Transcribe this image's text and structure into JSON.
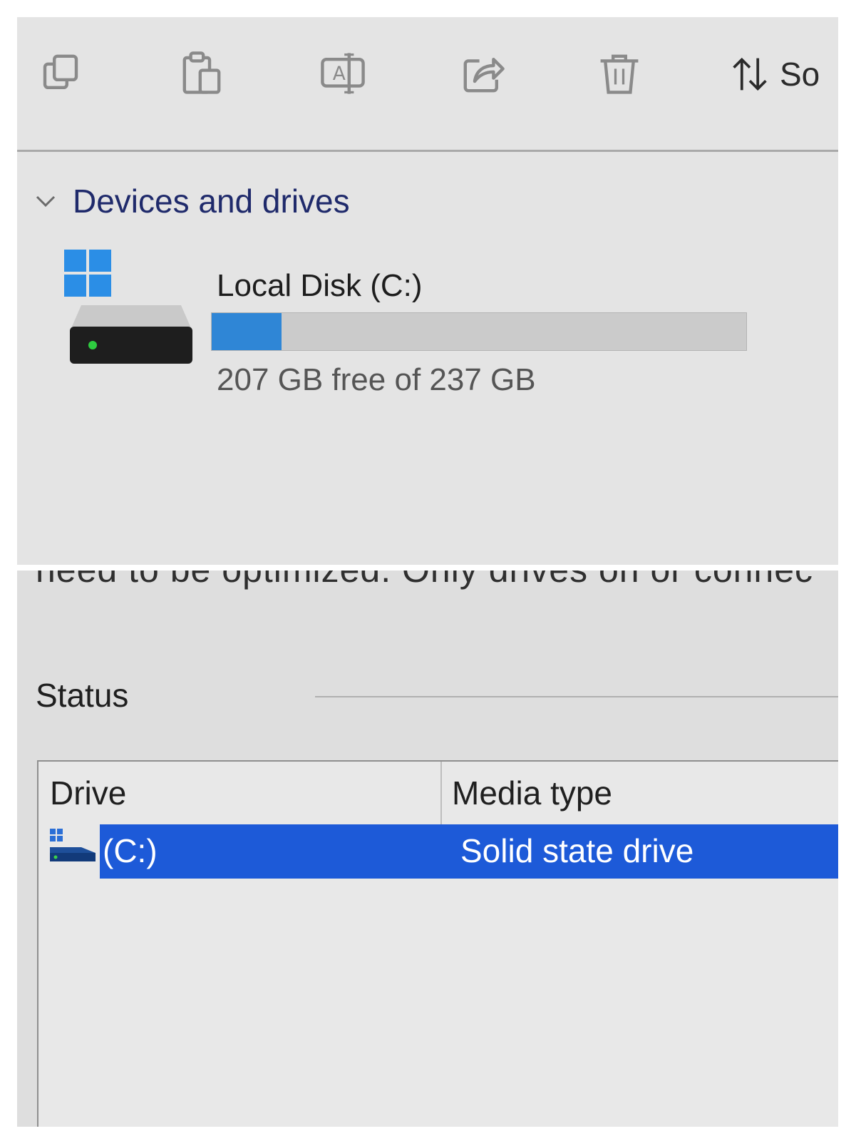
{
  "toolbar": {
    "buttons": [
      {
        "name": "copy",
        "icon": "copy-icon"
      },
      {
        "name": "paste",
        "icon": "paste-icon"
      },
      {
        "name": "rename",
        "icon": "rename-icon"
      },
      {
        "name": "share",
        "icon": "share-icon"
      },
      {
        "name": "delete",
        "icon": "trash-icon"
      }
    ],
    "sort_label": "So"
  },
  "section": {
    "title": "Devices and drives",
    "drives": [
      {
        "name": "Local Disk (C:)",
        "free_text": "207 GB free of 237 GB",
        "used_fraction": 0.13
      }
    ]
  },
  "optimize": {
    "description_fragment": "need to be optimized. Only drives on or connec",
    "status_label": "Status",
    "columns": {
      "drive": "Drive",
      "media_type": "Media type"
    },
    "rows": [
      {
        "drive": "(C:)",
        "media_type": "Solid state drive",
        "selected": true
      }
    ]
  },
  "colors": {
    "accent": "#2f86d6",
    "selection": "#1d5ad8",
    "section_title": "#1f2a6b"
  }
}
